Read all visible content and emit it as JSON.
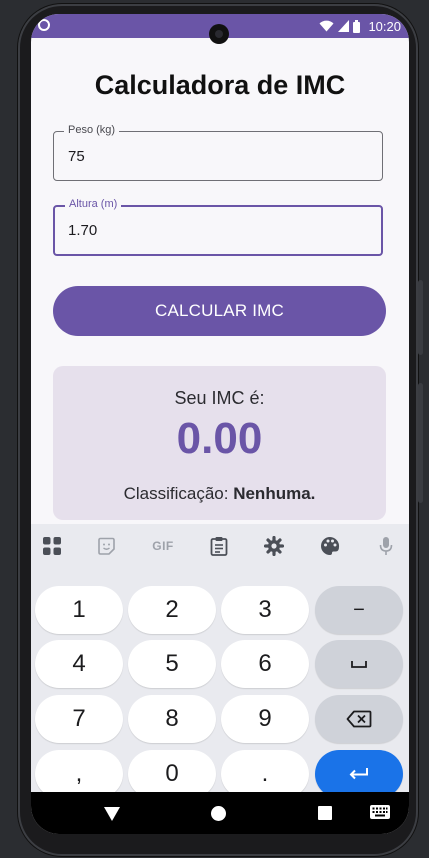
{
  "status_bar": {
    "time": "10:20"
  },
  "app": {
    "title": "Calculadora de IMC",
    "weight_field": {
      "label": "Peso (kg)",
      "value": "75"
    },
    "height_field": {
      "label": "Altura (m)",
      "value": "1.70"
    },
    "calculate_button": "CALCULAR IMC",
    "result": {
      "label": "Seu IMC é:",
      "value": "0.00",
      "classification_prefix": "Classificação:",
      "classification_value": "Nenhuma."
    }
  },
  "keyboard": {
    "toolbar_icons": [
      "apps-grid-icon",
      "sticker-icon",
      "gif-icon",
      "clipboard-icon",
      "gear-icon",
      "palette-icon",
      "mic-icon"
    ],
    "gif_label": "GIF",
    "keys": {
      "k1": "1",
      "k2": "2",
      "k3": "3",
      "minus": "−",
      "k4": "4",
      "k5": "5",
      "k6": "6",
      "k7": "7",
      "k8": "8",
      "k9": "9",
      "comma": ",",
      "k0": "0",
      "dot": "."
    }
  },
  "colors": {
    "accent": "#6a55a7",
    "card_bg": "#e6e0ec",
    "enter_key": "#1a73e8"
  }
}
